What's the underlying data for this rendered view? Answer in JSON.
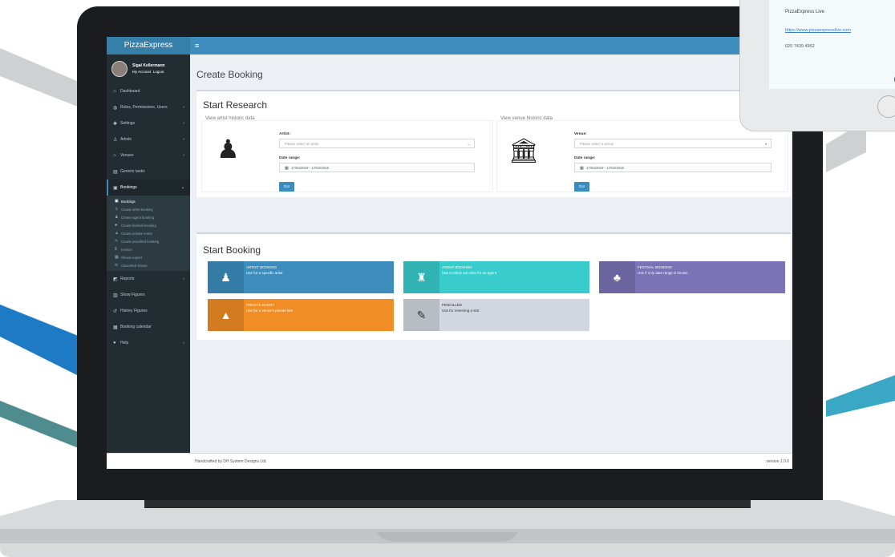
{
  "app": {
    "brand": "PizzaExpress",
    "menu_icon": "≡"
  },
  "user": {
    "name": "Sigal Kellermann",
    "my_account": "My Account",
    "logout": "Logout"
  },
  "sidebar": {
    "items": [
      {
        "label": "Dashboard",
        "icon": "dashboard-icon",
        "glyph": "⌂"
      },
      {
        "label": "Roles, Permissions, Users",
        "icon": "globe-icon",
        "glyph": "◍",
        "arrow": "‹"
      },
      {
        "label": "Settings",
        "icon": "gear-icon",
        "glyph": "✱",
        "arrow": "‹"
      },
      {
        "label": "Artists",
        "icon": "artist-icon",
        "glyph": "♙",
        "arrow": "‹"
      },
      {
        "label": "Venues",
        "icon": "venue-icon",
        "glyph": "⌂",
        "arrow": "‹"
      },
      {
        "label": "Generic tasks",
        "icon": "tasks-icon",
        "glyph": "▤"
      },
      {
        "label": "Bookings",
        "icon": "bookings-icon",
        "glyph": "▣",
        "arrow": "⌄"
      }
    ],
    "sub_items": [
      {
        "label": "Bookings",
        "glyph": "▣"
      },
      {
        "label": "Create artist booking",
        "glyph": "♙"
      },
      {
        "label": "Create agent booking",
        "glyph": "♟"
      },
      {
        "label": "Create festival booking",
        "glyph": "♣"
      },
      {
        "label": "Create private event",
        "glyph": "▲"
      },
      {
        "label": "Create pencilled booking",
        "glyph": "✎"
      },
      {
        "label": "Invoice",
        "glyph": "$"
      },
      {
        "label": "Shows export",
        "glyph": "▦"
      },
      {
        "label": "Cancelled shows",
        "glyph": "⊘"
      }
    ],
    "items_after": [
      {
        "label": "Reports",
        "icon": "reports-icon",
        "glyph": "◩",
        "arrow": "‹"
      },
      {
        "label": "Show Figures",
        "icon": "figures-icon",
        "glyph": "▥"
      },
      {
        "label": "History Figures",
        "icon": "history-icon",
        "glyph": "↺"
      },
      {
        "label": "Booking calendar",
        "icon": "calendar-icon",
        "glyph": "▦"
      },
      {
        "label": "Help",
        "icon": "help-icon",
        "glyph": "●",
        "arrow": "‹"
      }
    ]
  },
  "page": {
    "title": "Create Booking"
  },
  "research": {
    "title": "Start Research",
    "artist": {
      "section": "View artist historic data",
      "label": "Artist:",
      "placeholder": "Please select an artist",
      "date_label": "Date range:",
      "date_value": "17/04/2018 - 17/04/2018",
      "go": "Go!"
    },
    "venue": {
      "section": "View venue historic data",
      "label": "Venue:",
      "placeholder": "Please select a venue",
      "date_label": "Date range:",
      "date_value": "17/04/2018 - 17/04/2018",
      "go": "Go!"
    }
  },
  "booking": {
    "title": "Start Booking",
    "tiles": [
      {
        "title": "ARTIST BOOKING",
        "desc": "Use for a specific artist",
        "color": "#3c8dbc",
        "glyph": "♟",
        "icon": "artist-icon"
      },
      {
        "title": "AGENT BOOKING",
        "desc": "Use to block out slots for an agent",
        "color": "#39cccc",
        "glyph": "♜",
        "icon": "agent-icon"
      },
      {
        "title": "FESTIVAL BOOKING",
        "desc": "Use if only date range is known",
        "color": "#7a73b5",
        "glyph": "♣",
        "icon": "festival-icon"
      },
      {
        "title": "PRIVATE EVENT",
        "desc": "Use for a venue's private hire",
        "color": "#f08d25",
        "glyph": "▲",
        "icon": "lock-icon"
      },
      {
        "title": "PENCILLED",
        "desc": "Use for reserving a slot",
        "color": "#d2d6de",
        "glyph": "✎",
        "icon": "pencil-icon"
      }
    ]
  },
  "footer": {
    "text": "Handcrafted by DH System Designs Ltd.",
    "version": "version 1.0.0"
  },
  "tablet": {
    "name": "PizzaExpress Live",
    "url": "https://www.pizzaexpresslive.com",
    "phone": "020 7439 4962"
  }
}
